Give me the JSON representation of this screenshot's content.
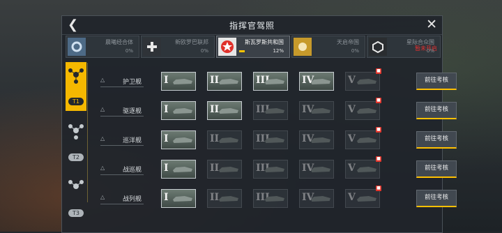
{
  "header": {
    "title": "指挥官驾照"
  },
  "tabs": [
    {
      "name": "晨曦经合体",
      "percent": "0%",
      "active": false,
      "color": "#4d6a86",
      "icon": "ring-icon"
    },
    {
      "name": "新欧罗巴联邦",
      "percent": "0%",
      "active": false,
      "color": "#2f3338",
      "icon": "cross-icon"
    },
    {
      "name": "斯瓦罗斯共和国",
      "percent": "12%",
      "progress": 0.12,
      "active": true,
      "color": "#e0302a",
      "icon": "star-icon"
    },
    {
      "name": "天启帝国",
      "percent": "0%",
      "active": false,
      "color": "#c79a2b",
      "icon": "circle-icon"
    },
    {
      "name": "星际合众国",
      "percent": "0%",
      "locked_label": "暂未开启",
      "active": false,
      "color": "#2a2d30",
      "icon": "cube-icon"
    }
  ],
  "tiers": [
    {
      "label": "T1",
      "active": true,
      "icon": "molecule-icon"
    },
    {
      "label": "T2",
      "active": false,
      "icon": "molecule-icon"
    },
    {
      "label": "T3",
      "active": false,
      "icon": "molecule-icon"
    }
  ],
  "rows": [
    {
      "name": "护卫舰",
      "button": "前往考核",
      "slots": [
        {
          "num": "I",
          "state": "done"
        },
        {
          "num": "II",
          "state": "done"
        },
        {
          "num": "III",
          "state": "done"
        },
        {
          "num": "IV",
          "state": "done"
        },
        {
          "num": "V",
          "state": "locked"
        }
      ]
    },
    {
      "name": "驱逐舰",
      "button": "前往考核",
      "slots": [
        {
          "num": "I",
          "state": "done"
        },
        {
          "num": "II",
          "state": "done"
        },
        {
          "num": "III",
          "state": "dim"
        },
        {
          "num": "IV",
          "state": "dim"
        },
        {
          "num": "V",
          "state": "locked"
        }
      ]
    },
    {
      "name": "巡洋舰",
      "button": "前往考核",
      "slots": [
        {
          "num": "I",
          "state": "done"
        },
        {
          "num": "II",
          "state": "dim"
        },
        {
          "num": "III",
          "state": "dim"
        },
        {
          "num": "IV",
          "state": "dim"
        },
        {
          "num": "V",
          "state": "locked"
        }
      ]
    },
    {
      "name": "战巡舰",
      "button": "前往考核",
      "slots": [
        {
          "num": "I",
          "state": "done"
        },
        {
          "num": "II",
          "state": "dim"
        },
        {
          "num": "III",
          "state": "dim"
        },
        {
          "num": "IV",
          "state": "dim"
        },
        {
          "num": "V",
          "state": "locked"
        }
      ]
    },
    {
      "name": "战列舰",
      "button": "前往考核",
      "slots": [
        {
          "num": "I",
          "state": "done"
        },
        {
          "num": "II",
          "state": "dim"
        },
        {
          "num": "III",
          "state": "dim"
        },
        {
          "num": "IV",
          "state": "dim"
        },
        {
          "num": "V",
          "state": "locked"
        }
      ]
    }
  ]
}
